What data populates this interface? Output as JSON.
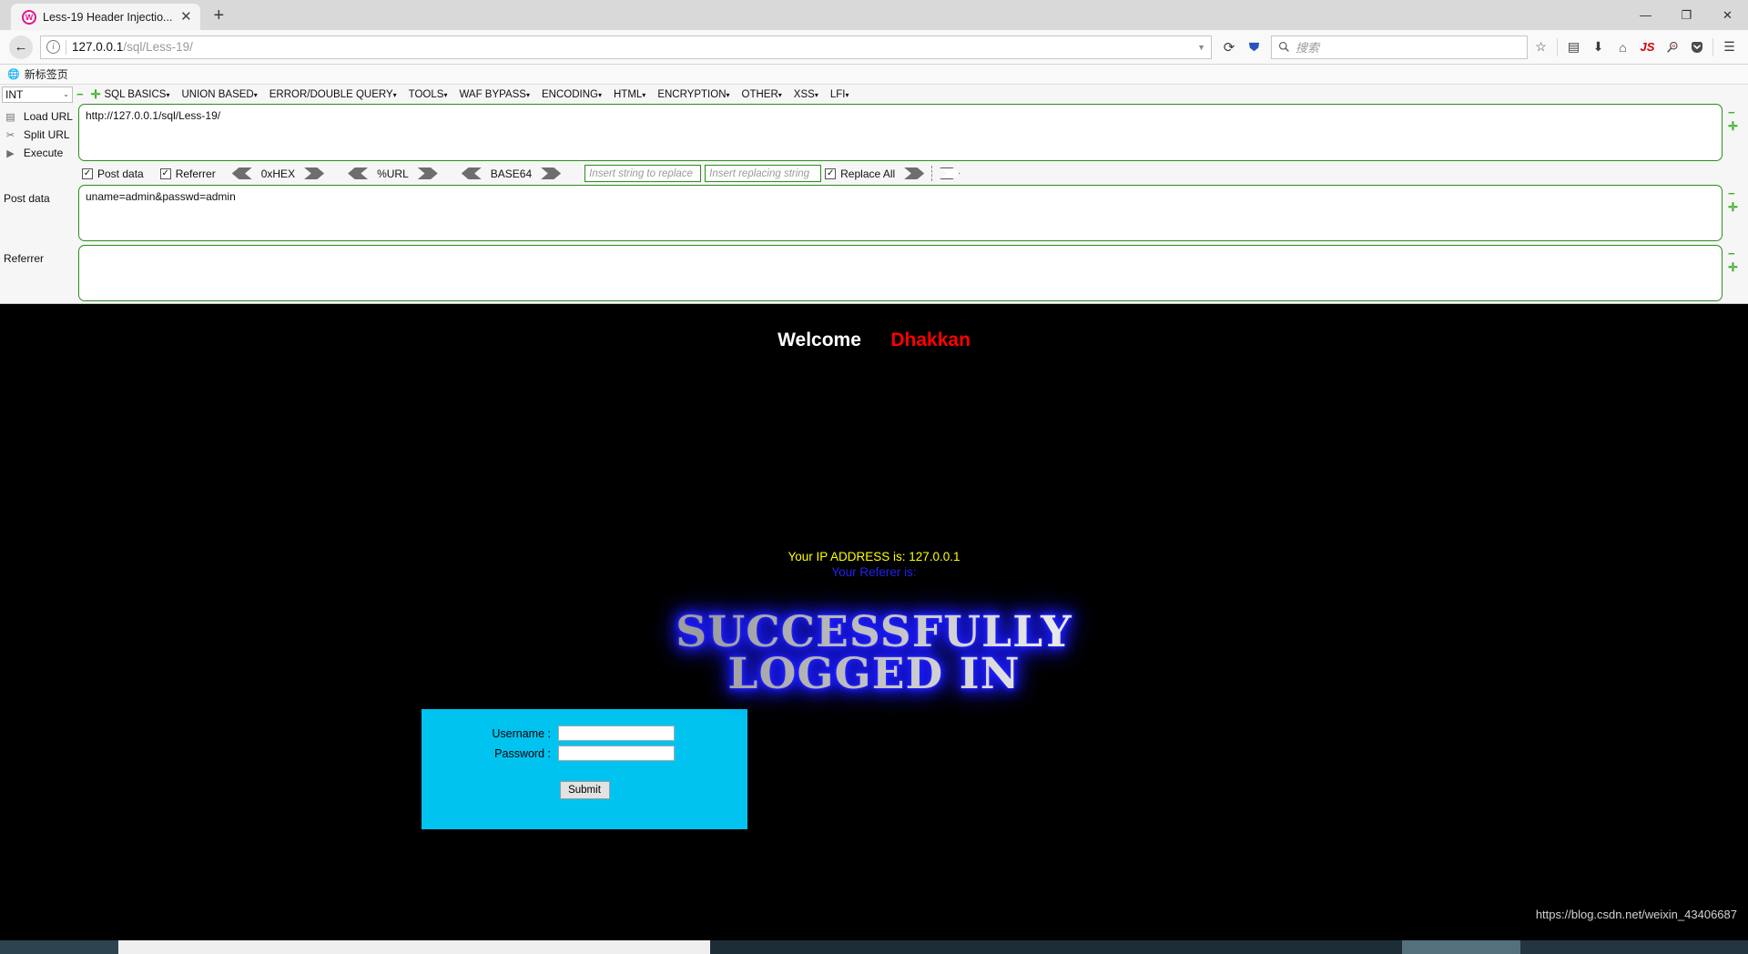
{
  "browser": {
    "tab": {
      "title": "Less-19 Header Injectio...",
      "favicon_text": "W",
      "close_label": "✕"
    },
    "new_tab_label": "+",
    "window_controls": {
      "minimize": "—",
      "maximize": "❐",
      "close": "✕"
    },
    "nav": {
      "back": "←",
      "info_icon": "i"
    },
    "url": {
      "host": "127.0.0.1",
      "path": "/sql/Less-19/",
      "dropdown": "▼",
      "reload": "⟳"
    },
    "pocket_icon": "pocket-icon",
    "search": {
      "placeholder": "搜索",
      "icon": "search-icon"
    },
    "toolbar_icons": [
      {
        "name": "bookmark-star-icon",
        "glyph": "☆"
      },
      {
        "name": "library-icon",
        "glyph": "▤"
      },
      {
        "name": "downloads-icon",
        "glyph": "⬇"
      },
      {
        "name": "home-icon",
        "glyph": "⌂"
      },
      {
        "name": "javascript-toggle-icon",
        "glyph": "JS"
      },
      {
        "name": "wappalyzer-icon",
        "glyph": "🔍"
      },
      {
        "name": "pocket-save-icon",
        "glyph": "▼"
      },
      {
        "name": "menu-hamburger-icon",
        "glyph": "☰"
      }
    ],
    "bookmarks": [
      {
        "label": "新标签页",
        "icon": "globe-icon"
      }
    ]
  },
  "hackbar": {
    "type_select": {
      "value": "INT",
      "chevron": "⌄"
    },
    "minus_label": "−",
    "plus_label": "✛",
    "menus": [
      {
        "label": "SQL BASICS"
      },
      {
        "label": "UNION BASED"
      },
      {
        "label": "ERROR/DOUBLE QUERY"
      },
      {
        "label": "TOOLS"
      },
      {
        "label": "WAF BYPASS"
      },
      {
        "label": "ENCODING"
      },
      {
        "label": "HTML"
      },
      {
        "label": "ENCRYPTION"
      },
      {
        "label": "OTHER"
      },
      {
        "label": "XSS"
      },
      {
        "label": "LFI"
      }
    ],
    "caret": "▾",
    "actions": [
      {
        "label": "Load URL",
        "icon": "load-url-icon",
        "glyph": "▤"
      },
      {
        "label": "Split URL",
        "icon": "split-url-icon",
        "glyph": "✂"
      },
      {
        "label": "Execute",
        "icon": "execute-icon",
        "glyph": "▶"
      }
    ],
    "url_value": "http://127.0.0.1/sql/Less-19/",
    "options": {
      "post_data": {
        "label": "Post data",
        "checked": "✓"
      },
      "referrer": {
        "label": "Referrer",
        "checked": "✓"
      },
      "hex": {
        "label": "0xHEX"
      },
      "url_enc": {
        "label": "%URL"
      },
      "base64": {
        "label": "BASE64"
      },
      "replace_from_placeholder": "Insert string to replace",
      "replace_to_placeholder": "Insert replacing string",
      "replace_all": {
        "label": "Replace All",
        "checked": "✓"
      }
    },
    "post_data_label": "Post data",
    "post_data_value": "uname=admin&passwd=admin",
    "referrer_label": "Referrer",
    "referrer_value": ""
  },
  "page": {
    "welcome_text": "Welcome",
    "user_name": "Dhakkan",
    "form": {
      "username_label": "Username :",
      "password_label": "Password :",
      "username_value": "",
      "password_value": "",
      "submit_label": "Submit"
    },
    "ip_line": "Your IP ADDRESS is: 127.0.0.1",
    "referer_line": "Your Referer is:",
    "banner_line1": "SUCCESSFULLY",
    "banner_line2": "LOGGED IN",
    "watermark": "https://blog.csdn.net/weixin_43406687"
  },
  "colors": {
    "login_box": "#00c3f0",
    "user_name": "#ff0000",
    "ip_text": "#ffff00",
    "referer_text": "#2222ee",
    "hackbar_border": "#2e8b1f",
    "hackbar_marker": "#3fae2a"
  }
}
